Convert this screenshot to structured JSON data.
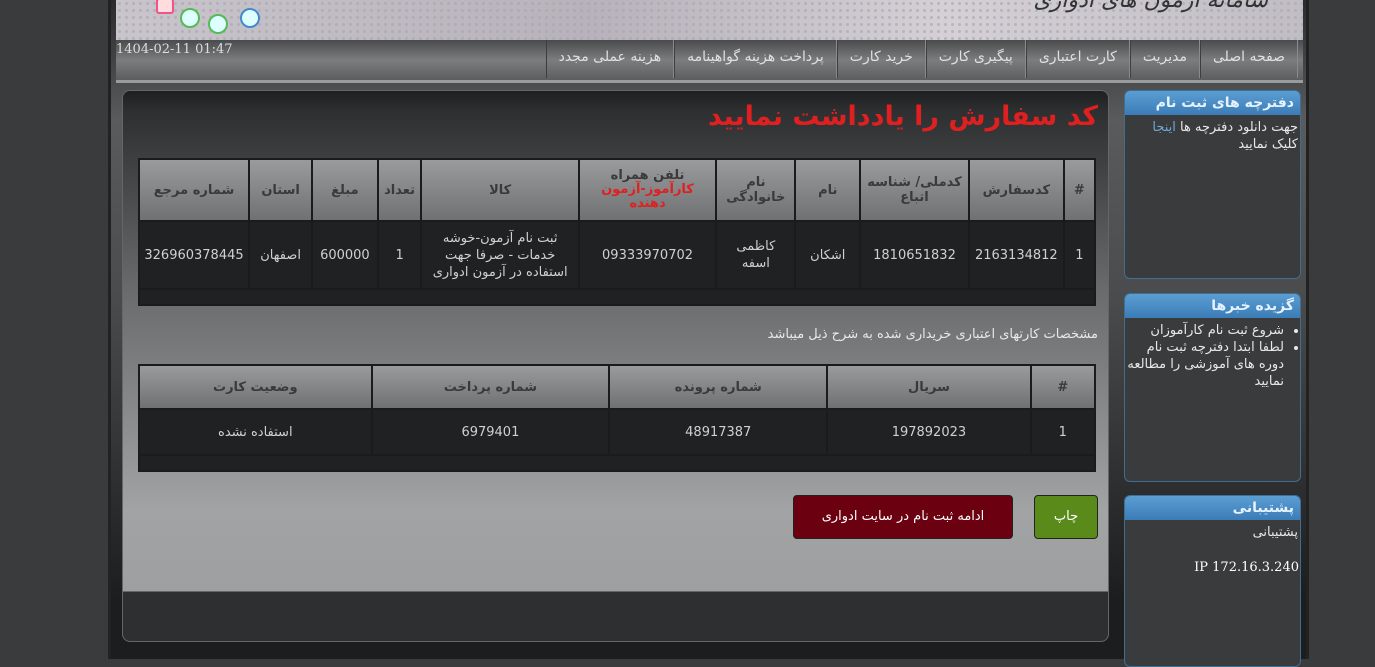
{
  "banner": {
    "title": "سامانه آزمون های ادواری"
  },
  "nav": {
    "datetime": "1404-02-11 01:47",
    "items": [
      "صفحه اصلی",
      "مدیریت",
      "کارت اعتباری",
      "پیگیری کارت",
      "خرید کارت",
      "پرداخت هزینه گواهینامه",
      "هزینه عملی مجدد"
    ]
  },
  "sidebar": {
    "downloads": {
      "title": "دفترچه های ثبت نام",
      "text_before": "جهت دانلود دفترچه ها ",
      "link": "اینجا",
      "text_after": " کلیک نمایید"
    },
    "news": {
      "title": "گزیده خبرها",
      "items": [
        "شروع ثبت نام کارآموزان",
        "لطفا ابتدا دفترچه ثبت نام دوره های آموزشی را مطالعه نمایید"
      ]
    },
    "support": {
      "title": "پشتیبانی",
      "text": "پشتیبانی"
    },
    "ip": "IP 172.16.3.240"
  },
  "main": {
    "heading": "کد سفارش را یادداشت نمایید",
    "order_table": {
      "headers": [
        "#",
        "کدسفارش",
        "کدملی/ شناسه اتباع",
        "نام",
        "نام خانوادگی",
        "تلفن همراه",
        "کالا",
        "تعداد",
        "مبلغ",
        "استان",
        "شماره مرجع"
      ],
      "phone_subheader": "کارآموز-آزمون دهنده",
      "row": [
        "1",
        "2163134812",
        "1810651832",
        "اشکان",
        "کاظمی اسفه",
        "09333970702",
        "ثبت نام آزمون-خوشه خدمات - صرفا جهت استفاده در آزمون ادواری",
        "1",
        "600000",
        "اصفهان",
        "326960378445"
      ]
    },
    "cards_note": "مشخصات کارتهای اعتباری خریداری شده به شرح ذیل میباشد",
    "cards_table": {
      "headers": [
        "#",
        "سریال",
        "شماره پرونده",
        "شماره پرداخت",
        "وضعیت کارت"
      ],
      "row": [
        "1",
        "197892023",
        "48917387",
        "6979401",
        "استفاده نشده"
      ]
    },
    "print_button": "چاپ",
    "continue_button": "ادامه ثبت نام در سایت ادواری"
  },
  "colors": {
    "heading_red": "#e02020",
    "print_green": "#5a8a1a",
    "continue_maroon": "#6a0010",
    "sidebar_blue": "#3b7cb7"
  }
}
